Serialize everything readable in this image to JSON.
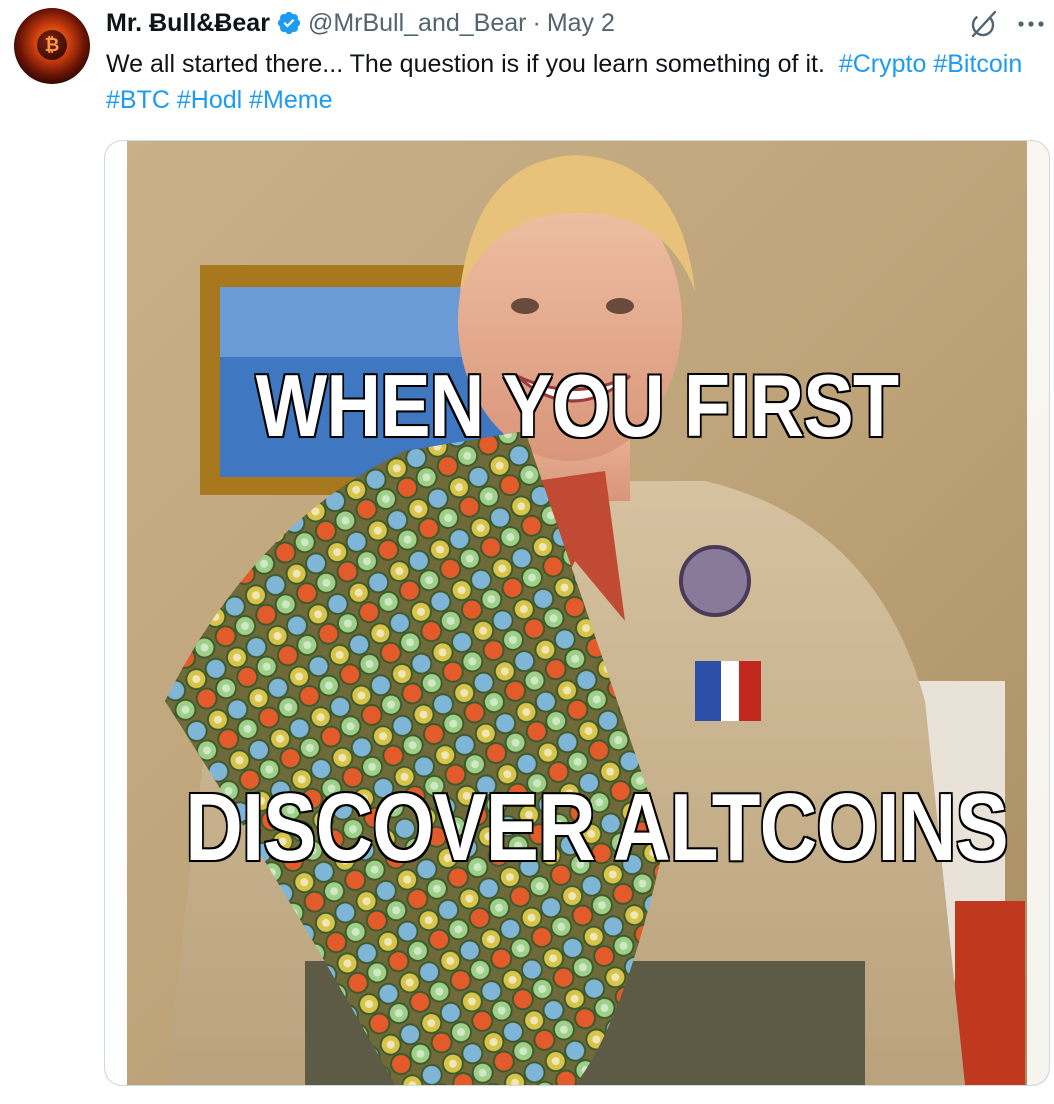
{
  "tweet": {
    "display_name": "Mr. Ƀull&Ƀear",
    "handle": "@MrBull_and_Bear",
    "separator": "·",
    "date": "May 2",
    "text": "We all started there... The question is if you learn something of it.",
    "hashtags": [
      "#Crypto",
      "#Bitcoin",
      "#BTC",
      "#Hodl",
      "#Meme"
    ],
    "avatar_icon": "bitcoin-fire-avatar",
    "verified_icon": "verified-badge-icon",
    "actions": {
      "grok_icon": "grok-icon",
      "more_icon": "more-options-icon"
    }
  },
  "media": {
    "caption_top": "WHEN YOU FIRST",
    "caption_bottom": "DISCOVER ALTCOINS"
  },
  "colors": {
    "link": "#1d9bf0",
    "verified": "#1d9bf0",
    "text_primary": "#0f1419",
    "text_secondary": "#536471"
  }
}
